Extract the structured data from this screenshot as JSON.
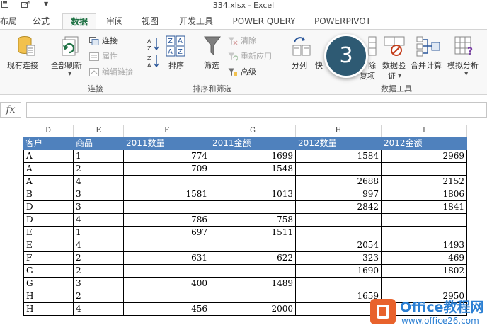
{
  "title_bar": {
    "title": "334.xlsx - Excel",
    "qa_icons": [
      "save-icon",
      "export-icon",
      "customize-icon"
    ]
  },
  "tabs": [
    {
      "label": "布局",
      "active": false
    },
    {
      "label": "公式",
      "active": false
    },
    {
      "label": "数据",
      "active": true
    },
    {
      "label": "审阅",
      "active": false
    },
    {
      "label": "视图",
      "active": false
    },
    {
      "label": "开发工具",
      "active": false
    },
    {
      "label": "POWER QUERY",
      "active": false
    },
    {
      "label": "POWERPIVOT",
      "active": false
    }
  ],
  "ribbon": {
    "connections": {
      "existing_connections": "现有连接",
      "refresh_all": "全部刷新",
      "connections": "连接",
      "properties": "属性",
      "edit_links": "编辑链接",
      "group_label": "连接"
    },
    "sort_filter": {
      "sort": "排序",
      "filter": "筛选",
      "clear": "清除",
      "reapply": "重新应用",
      "advanced": "高级",
      "group_label": "排序和筛选"
    },
    "data_tools": {
      "text_to_columns": "分列",
      "flash_fill": "快",
      "remove_dup_1": "除",
      "remove_dup_2": "复项",
      "data_validation_1": "数据验",
      "data_validation_2": "证",
      "consolidate": "合并计算",
      "what_if": "模拟分析",
      "group_label": "数据工具"
    }
  },
  "formula_bar": {
    "fx": "fx",
    "value": ""
  },
  "columns": [
    "D",
    "E",
    "F",
    "G",
    "H",
    "I"
  ],
  "table": {
    "headers": [
      "客户",
      "商品",
      "2011数量",
      "2011金额",
      "2012数量",
      "2012金额"
    ],
    "rows": [
      [
        "A",
        "1",
        "774",
        "1699",
        "1584",
        "2969"
      ],
      [
        "A",
        "2",
        "709",
        "1548",
        "",
        ""
      ],
      [
        "A",
        "4",
        "",
        "",
        "2688",
        "2152"
      ],
      [
        "B",
        "3",
        "1581",
        "1013",
        "997",
        "1806"
      ],
      [
        "D",
        "3",
        "",
        "",
        "2842",
        "1841"
      ],
      [
        "D",
        "4",
        "786",
        "758",
        "",
        ""
      ],
      [
        "E",
        "1",
        "697",
        "1511",
        "",
        ""
      ],
      [
        "E",
        "4",
        "",
        "",
        "2054",
        "1493"
      ],
      [
        "F",
        "2",
        "631",
        "622",
        "323",
        "469"
      ],
      [
        "G",
        "2",
        "",
        "",
        "1690",
        "1802"
      ],
      [
        "G",
        "3",
        "400",
        "1489",
        "",
        ""
      ],
      [
        "H",
        "2",
        "",
        "",
        "1659",
        "2950"
      ],
      [
        "H",
        "4",
        "456",
        "2000",
        "",
        ""
      ]
    ]
  },
  "step_badge": "3",
  "watermark": {
    "brand": "Office教程网",
    "url": "www.office26.com"
  }
}
